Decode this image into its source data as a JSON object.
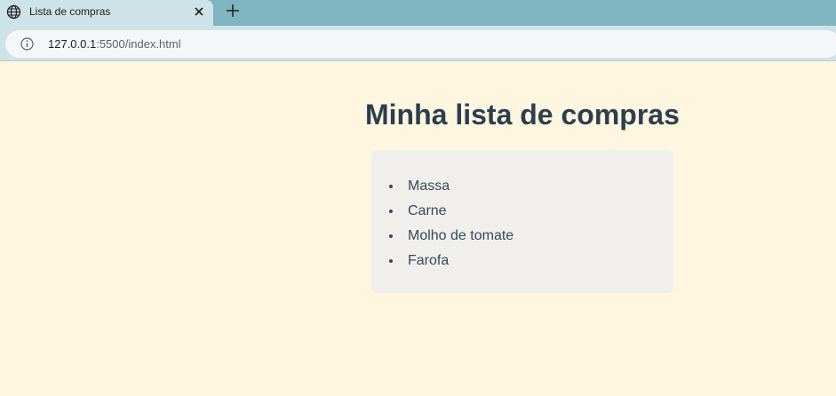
{
  "browser": {
    "tab": {
      "title": "Lista de compras",
      "icon": "globe-icon"
    },
    "address": {
      "host": "127.0.0.1",
      "rest": ":5500/index.html"
    }
  },
  "page": {
    "heading": "Minha lista de compras",
    "items": [
      "Massa",
      "Carne",
      "Molho de tomate",
      "Farofa"
    ]
  },
  "colors": {
    "background": "#fff6e0",
    "card": "#f1efeb",
    "heading": "#2c3e50",
    "item_text": "#34495e"
  }
}
